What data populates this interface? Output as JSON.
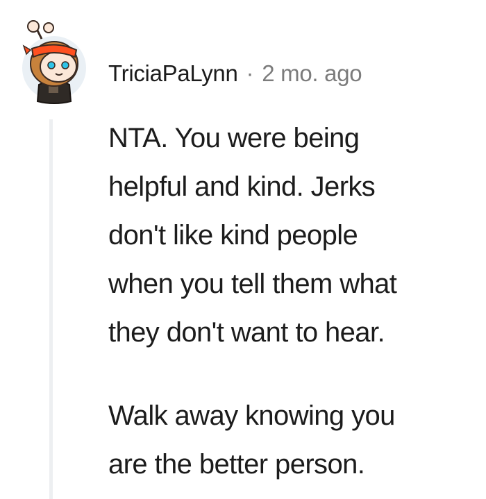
{
  "comment": {
    "avatar_icon": "snoo-avatar-icon",
    "username": "TriciaPaLynn",
    "separator": "·",
    "timestamp": "2 mo. ago",
    "paragraphs": [
      {
        "lines": [
          "NTA. You were being",
          "helpful and kind. Jerks",
          "don't like kind people",
          "when you tell them what",
          "they don't want to hear."
        ]
      },
      {
        "lines": [
          "Walk away knowing you",
          "are the better person."
        ]
      }
    ]
  },
  "colors": {
    "text": "#1c1c1c",
    "meta": "#7c7c7c",
    "thread_line": "#edeff1",
    "avatar_bg": "#eaf0f5",
    "headband": "#ff5020",
    "hair": "#c8823c",
    "eyes": "#2ec4e8"
  }
}
